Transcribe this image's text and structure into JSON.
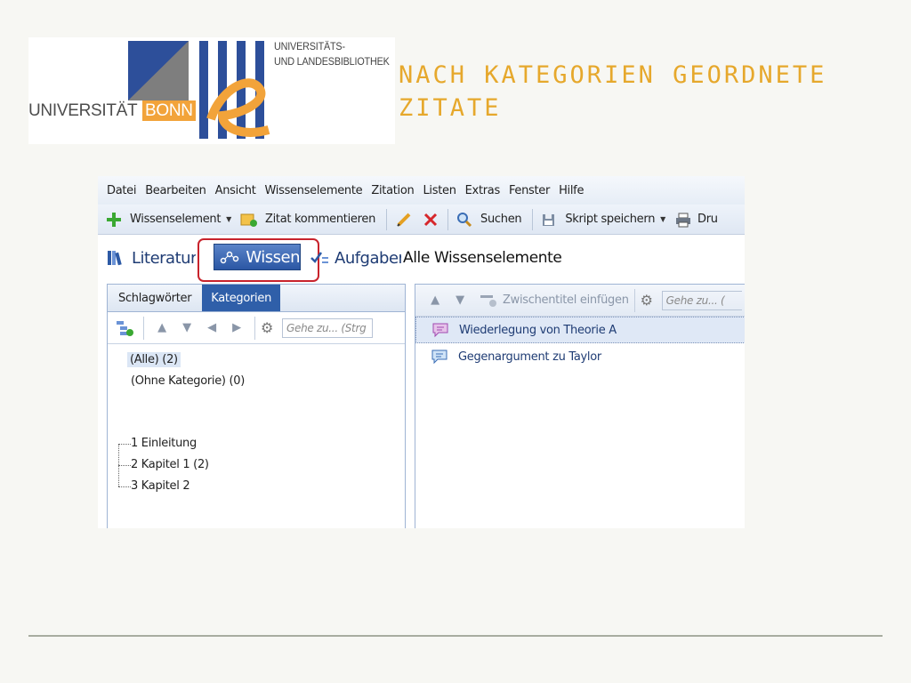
{
  "logo": {
    "bonn_text": "UNIVERSITÄT",
    "bonn_box_text": "BONN",
    "ulb_line1": "UNIVERSITÄTS-",
    "ulb_line2": "UND LANDESBIBLIOTHEK"
  },
  "slide_title": {
    "line1": "NACH KATEGORIEN GEORDNETE",
    "line2": "ZITATE"
  },
  "app": {
    "menu": [
      "Datei",
      "Bearbeiten",
      "Ansicht",
      "Wissenselemente",
      "Zitation",
      "Listen",
      "Extras",
      "Fenster",
      "Hilfe"
    ],
    "toolbar": {
      "wissenselement": "Wissenselement",
      "zitat_kommentieren": "Zitat kommentieren",
      "suchen": "Suchen",
      "skript_speichern": "Skript speichern",
      "drucken": "Dru"
    },
    "views": {
      "literatur": "Literatur",
      "wissen": "Wissen",
      "aufgaben": "Aufgaben",
      "title": "Alle Wissenselemente"
    },
    "left_panel": {
      "tabs": [
        "Schlagwörter",
        "Kategorien"
      ],
      "active_tab": "Kategorien",
      "search_placeholder": "Gehe zu... (Strg",
      "items": [
        "(Alle) (2)",
        "(Ohne Kategorie) (0)",
        "1 Einleitung",
        "2 Kapitel 1 (2)",
        "3 Kapitel 2"
      ]
    },
    "right_panel": {
      "zwischentitel": "Zwischentitel einfügen",
      "search_placeholder": "Gehe zu... (",
      "items": [
        "Wiederlegung von Theorie A",
        "Gegenargument zu Taylor"
      ]
    }
  },
  "colors": {
    "title_accent": "#e6a82c",
    "bonn_orange": "#f2a33a",
    "bonn_blue": "#2d4f9a",
    "highlight_red": "#c8232c",
    "selected_tab_blue": "#2f5fa9"
  }
}
